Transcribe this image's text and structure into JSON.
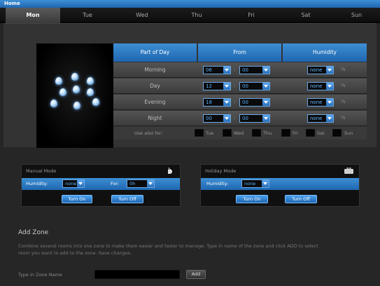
{
  "window": {
    "title": "Home"
  },
  "tabs": [
    "Mon",
    "Tue",
    "Wed",
    "Thu",
    "Fri",
    "Sat",
    "Sun"
  ],
  "schedule": {
    "headers": {
      "part": "Part of Day",
      "from": "From",
      "humidity": "Humidity"
    },
    "rows": [
      {
        "label": "Morning",
        "hour": "06",
        "minute": "00",
        "humidity": "none",
        "unit": "%"
      },
      {
        "label": "Day",
        "hour": "12",
        "minute": "00",
        "humidity": "none",
        "unit": "%"
      },
      {
        "label": "Evening",
        "hour": "18",
        "minute": "00",
        "humidity": "none",
        "unit": "%"
      },
      {
        "label": "Night",
        "hour": "00",
        "minute": "00",
        "humidity": "none",
        "unit": "%"
      }
    ],
    "colon": ":",
    "use_also": {
      "label": "Use also for:",
      "days": [
        "Tue",
        "Wed",
        "Thu",
        "Fri",
        "Sat",
        "Sun"
      ]
    }
  },
  "manual_mode": {
    "title": "Manual Mode",
    "humidity_label": "Humidity:",
    "humidity_value": "none",
    "for_label": "For:",
    "for_value": "0h",
    "on_button": "Turn On",
    "off_button": "Turn Off",
    "icon": "hand-icon"
  },
  "holiday_mode": {
    "title": "Holiday Mode",
    "humidity_label": "Humidity:",
    "humidity_value": "none",
    "on_button": "Turn On",
    "off_button": "Turn Off",
    "icon": "suitcase-icon"
  },
  "add_zone": {
    "title": "Add Zone",
    "description": "Combine several rooms into one zone to make them easier and faster to manage. Type in name of the zone and click ADD to select room you want to add to the zone. Save changes.",
    "input_label": "Type in Zone Name",
    "input_value": "",
    "add_button": "Add"
  },
  "colors": {
    "accent": "#2a7cc8",
    "background": "#262626",
    "text_blue": "#5cb3ff"
  }
}
